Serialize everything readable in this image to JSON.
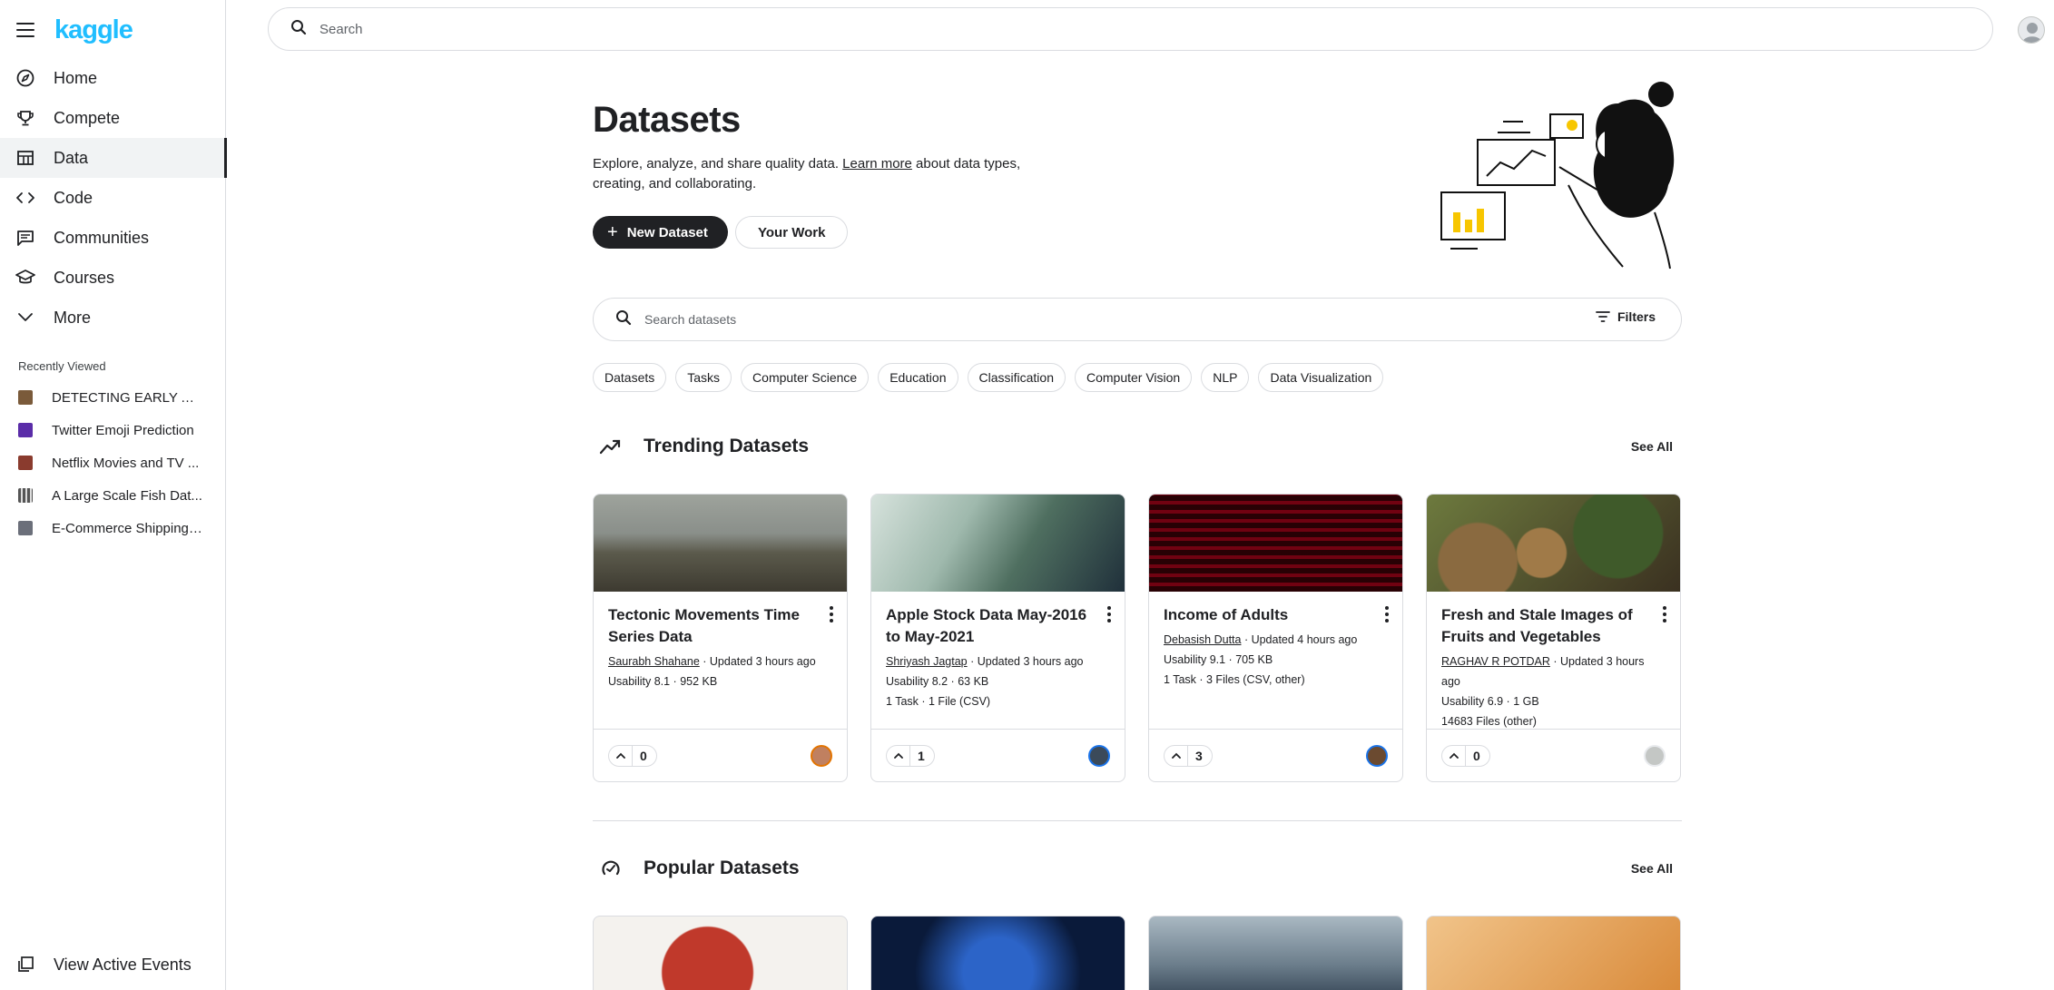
{
  "brand": {
    "logo": "kaggle"
  },
  "nav": [
    {
      "label": "Home",
      "icon": "compass-icon"
    },
    {
      "label": "Compete",
      "icon": "trophy-icon"
    },
    {
      "label": "Data",
      "icon": "table-icon",
      "active": true
    },
    {
      "label": "Code",
      "icon": "code-icon"
    },
    {
      "label": "Communities",
      "icon": "comments-icon"
    },
    {
      "label": "Courses",
      "icon": "school-icon"
    },
    {
      "label": "More",
      "icon": "chevron-down-icon"
    }
  ],
  "recent": {
    "header": "Recently Viewed",
    "items": [
      {
        "label": "DETECTING EARLY AL...",
        "color": "#7a5a3a"
      },
      {
        "label": "Twitter Emoji Prediction",
        "color": "#5a2ca8"
      },
      {
        "label": "Netflix Movies and TV ...",
        "color": "#8a3b2e"
      },
      {
        "label": "A Large Scale Fish Dat...",
        "color": "#555555"
      },
      {
        "label": "E-Commerce Shipping ...",
        "color": "#6b6f7a"
      }
    ]
  },
  "footer_nav": {
    "label": "View Active Events"
  },
  "top_search": {
    "placeholder": "Search"
  },
  "hero": {
    "title": "Datasets",
    "desc_before": "Explore, analyze, and share quality data. ",
    "desc_link": "Learn more",
    "desc_after": " about data types, creating, and collaborating.",
    "new_dataset": "New Dataset",
    "your_work": "Your Work"
  },
  "dataset_search": {
    "placeholder": "Search datasets",
    "filters": "Filters"
  },
  "chips": [
    "Datasets",
    "Tasks",
    "Computer Science",
    "Education",
    "Classification",
    "Computer Vision",
    "NLP",
    "Data Visualization"
  ],
  "trending": {
    "title": "Trending Datasets",
    "see_all": "See All",
    "cards": [
      {
        "title": "Tectonic Movements Time Series Data",
        "owner": "Saurabh Shahane",
        "updated": " · Updated 3 hours ago",
        "line2": "Usability 8.1 · 952 KB",
        "line3": "",
        "votes": "0",
        "avatar_color": "#e37400",
        "img_top": "#8a8f8a",
        "img_bottom": "#4a4a40"
      },
      {
        "title": "Apple Stock Data May-2016 to May-2021",
        "owner": "Shriyash Jagtap",
        "updated": " · Updated 3 hours ago",
        "line2": "Usability 8.2 · 63 KB",
        "line3": "1 Task · 1 File (CSV)",
        "votes": "1",
        "avatar_color": "#1a73e8",
        "img_top": "#bfd3c9",
        "img_bottom": "#2e4a3c"
      },
      {
        "title": "Income of Adults",
        "owner": "Debasish Dutta",
        "updated": " · Updated 4 hours ago",
        "line2": "Usability 9.1 · 705 KB",
        "line3": "1 Task · 3 Files (CSV, other)",
        "votes": "3",
        "avatar_color": "#1a73e8",
        "img_top": "#c2184d",
        "img_bottom": "#3a0a14"
      },
      {
        "title": "Fresh and Stale Images of Fruits and Vegetables",
        "owner": "RAGHAV R POTDAR",
        "updated": " · Updated 3 hours ago",
        "line2": "Usability 6.9 · 1 GB",
        "line3": "14683 Files (other)",
        "votes": "0",
        "avatar_color": "#9aa0a6",
        "img_top": "#7c8a4a",
        "img_bottom": "#4a3a22"
      }
    ]
  },
  "popular": {
    "title": "Popular Datasets",
    "see_all": "See All",
    "cards": [
      {
        "img_top": "#f4f2ee",
        "img_bottom": "#b3342a"
      },
      {
        "img_top": "#0a1a3a",
        "img_bottom": "#1f4fa8"
      },
      {
        "img_top": "#8aa0b0",
        "img_bottom": "#3a4a5a"
      },
      {
        "img_top": "#e8b070",
        "img_bottom": "#c0742a"
      }
    ]
  }
}
